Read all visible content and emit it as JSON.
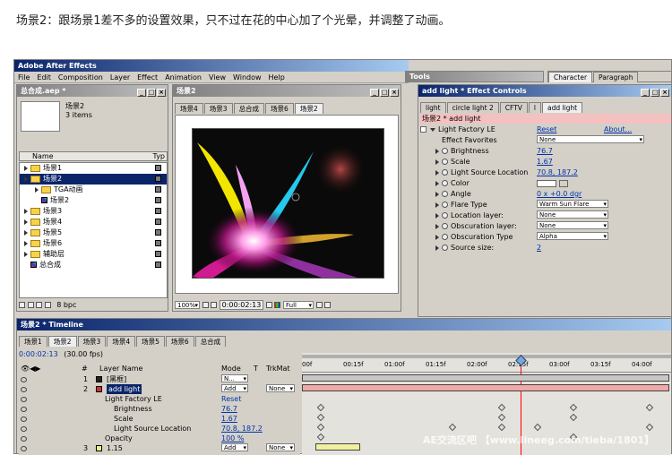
{
  "caption": "场景2：跟场景1差不多的设置效果，只不过在花的中心加了个光晕，并调整了动画。",
  "app": {
    "title": "Adobe After Effects",
    "menu": [
      "File",
      "Edit",
      "Composition",
      "Layer",
      "Effect",
      "Animation",
      "View",
      "Window",
      "Help"
    ]
  },
  "project": {
    "title": "总合成.aep *",
    "preview_name": "场景2",
    "preview_items": "3 items",
    "col_name": "Name",
    "col_type": "Typ",
    "items": [
      {
        "label": "场景1",
        "kind": "folder"
      },
      {
        "label": "场景2",
        "kind": "folder",
        "selected": true
      },
      {
        "label": "TGA动画",
        "kind": "folder",
        "indent": 1
      },
      {
        "label": "场景2",
        "kind": "comp",
        "indent": 1
      },
      {
        "label": "场景3",
        "kind": "folder"
      },
      {
        "label": "场景4",
        "kind": "folder"
      },
      {
        "label": "场景5",
        "kind": "folder"
      },
      {
        "label": "场景6",
        "kind": "folder"
      },
      {
        "label": "辅助层",
        "kind": "folder"
      },
      {
        "label": "总合成",
        "kind": "comp"
      }
    ],
    "bpc": "8 bpc"
  },
  "comp": {
    "title": "场景2",
    "tabs": [
      "场景4",
      "场景3",
      "总合成",
      "场景6",
      "场景2"
    ],
    "zoom": "100%",
    "time": "0:00:02:13",
    "resolution": "Full"
  },
  "tools": {
    "title": "Tools"
  },
  "charpanel": {
    "tabs": [
      "Character",
      "Paragraph"
    ]
  },
  "effects": {
    "title": "add light * Effect Controls",
    "tabs": [
      "light",
      "circle light 2",
      "CFTV",
      "l",
      "add light"
    ],
    "header": "场景2 * add light",
    "plugin": "Light Factory LE",
    "reset": "Reset",
    "about": "About...",
    "props": [
      {
        "label": "Effect Favorites",
        "value": "None",
        "type": "dd"
      },
      {
        "label": "Brightness",
        "value": "76.7"
      },
      {
        "label": "Scale",
        "value": "1.67"
      },
      {
        "label": "Light Source Location",
        "value": "70.8, 187.2"
      },
      {
        "label": "Color",
        "value": "",
        "type": "color"
      },
      {
        "label": "Angle",
        "value": "0 x +0.0 dgr"
      },
      {
        "label": "Flare Type",
        "value": "Warm Sun Flare",
        "type": "dd"
      },
      {
        "label": "Location layer:",
        "value": "None",
        "type": "dd"
      },
      {
        "label": "Obscuration layer:",
        "value": "None",
        "type": "dd"
      },
      {
        "label": "Obscuration Type",
        "value": "Alpha",
        "type": "dd"
      },
      {
        "label": "Source size:",
        "value": "2"
      }
    ]
  },
  "timeline": {
    "title": "场景2 * Timeline",
    "tabs": [
      "场景1",
      "场景2",
      "场景3",
      "场景4",
      "场景5",
      "场景6",
      "总合成"
    ],
    "time": "0:00:02:13",
    "fps": "(30.00 fps)",
    "col_num": "#",
    "col_layer": "Layer Name",
    "col_mode": "Mode",
    "col_t": "T",
    "col_trkmat": "TrkMat",
    "ruler": [
      "00f",
      "00:15f",
      "01:00f",
      "01:15f",
      "02:00f",
      "02:15f",
      "03:00f",
      "03:15f",
      "04:00f"
    ],
    "layers": [
      {
        "num": "1",
        "name": "[黑框]",
        "mode": "N...",
        "trk": ""
      },
      {
        "num": "2",
        "name": "add light",
        "mode": "Add",
        "trk": "None",
        "selected": true
      },
      {
        "num": "",
        "name": "Light Factory LE",
        "mode": "Reset",
        "trk": "",
        "sub": 1
      },
      {
        "num": "",
        "name": "Brightness",
        "mode": "76.7",
        "trk": "",
        "sub": 2
      },
      {
        "num": "",
        "name": "Scale",
        "mode": "1.67",
        "trk": "",
        "sub": 2
      },
      {
        "num": "",
        "name": "Light Source Location",
        "mode": "70.8, 187.2",
        "trk": "",
        "sub": 2
      },
      {
        "num": "",
        "name": "Opacity",
        "mode": "100 %",
        "trk": "",
        "sub": 1
      },
      {
        "num": "3",
        "name": "1.15",
        "mode": "Add",
        "trk": "None"
      }
    ]
  },
  "watermark": "AE交流区吧 【www.lineeg.com/tieba/1801】"
}
